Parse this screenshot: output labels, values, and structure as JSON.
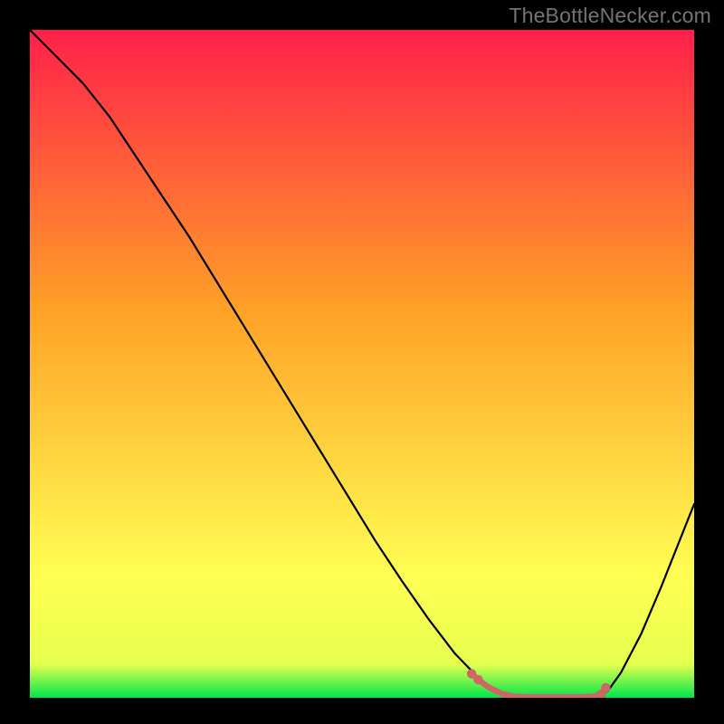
{
  "watermark": "TheBottleNecker.com",
  "chart_data": {
    "type": "line",
    "title": "",
    "xlabel": "",
    "ylabel": "",
    "xlim": [
      0,
      100
    ],
    "ylim": [
      0,
      100
    ],
    "grid": false,
    "legend": null,
    "background_gradient": {
      "top": "#ff204a",
      "upper_mid": "#ffa127",
      "lower_mid": "#ffff54",
      "bottom": "#00e64a"
    },
    "series": [
      {
        "name": "bottleneck-curve",
        "color": "#000000",
        "x": [
          0,
          4,
          8,
          12,
          16,
          20,
          24,
          28,
          32,
          36,
          40,
          44,
          48,
          52,
          56,
          60,
          64,
          68,
          71,
          73,
          75,
          77,
          79,
          81,
          83,
          85,
          87,
          89,
          92,
          95,
          98,
          100
        ],
        "y": [
          100,
          96,
          92,
          87,
          81,
          75,
          69,
          62.5,
          56,
          49.5,
          43,
          36.5,
          30,
          23.5,
          17.5,
          11.8,
          6.6,
          2.5,
          0.6,
          0.18,
          0.12,
          0.1,
          0.1,
          0.1,
          0.12,
          0.2,
          1.0,
          3.8,
          9.5,
          16.5,
          24,
          29
        ]
      },
      {
        "name": "optimal-highlight",
        "color": "#cf6666",
        "x": [
          66.5,
          67.5,
          69,
          71,
          73,
          75,
          77,
          79,
          81,
          83,
          85,
          86,
          86.7
        ],
        "y": [
          3.6,
          2.7,
          1.6,
          0.6,
          0.18,
          0.12,
          0.1,
          0.1,
          0.1,
          0.12,
          0.2,
          0.5,
          1.5
        ]
      }
    ],
    "optimal_markers": {
      "color": "#cf6666",
      "points": [
        {
          "x": 66.5,
          "y": 3.6
        },
        {
          "x": 67.5,
          "y": 2.7
        },
        {
          "x": 86.0,
          "y": 0.5
        },
        {
          "x": 86.7,
          "y": 1.5
        }
      ]
    }
  }
}
